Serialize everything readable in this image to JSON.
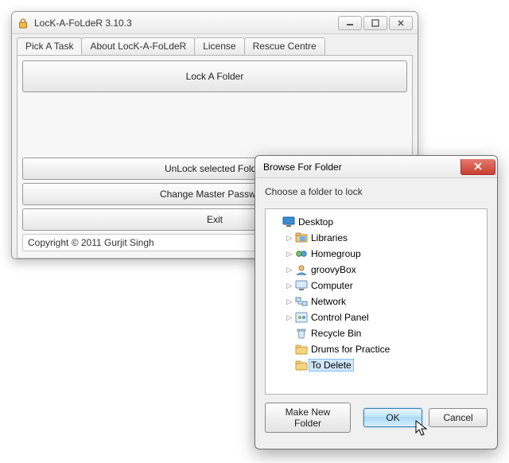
{
  "main": {
    "title": "LocK-A-FoLdeR 3.10.3",
    "tabs": [
      {
        "label": "Pick A Task"
      },
      {
        "label": "About LocK-A-FoLdeR"
      },
      {
        "label": "License"
      },
      {
        "label": "Rescue Centre"
      }
    ],
    "buttons": {
      "lock": "Lock A Folder",
      "unlock": "UnLock selected Folder",
      "change_pw": "Change Master Password",
      "exit": "Exit"
    },
    "copyright": "Copyright © 2011 Gurjit Singh"
  },
  "browse": {
    "title": "Browse For Folder",
    "instruction": "Choose a folder to lock",
    "tree": {
      "root": "Desktop",
      "items": [
        {
          "label": "Libraries",
          "icon": "libraries"
        },
        {
          "label": "Homegroup",
          "icon": "homegroup"
        },
        {
          "label": "groovyBox",
          "icon": "user"
        },
        {
          "label": "Computer",
          "icon": "computer"
        },
        {
          "label": "Network",
          "icon": "network"
        },
        {
          "label": "Control Panel",
          "icon": "control"
        },
        {
          "label": "Recycle Bin",
          "icon": "recycle",
          "noexpand": true
        },
        {
          "label": "Drums for Practice",
          "icon": "folder",
          "noexpand": true
        },
        {
          "label": "To Delete",
          "icon": "folder",
          "noexpand": true,
          "selected": true
        }
      ]
    },
    "buttons": {
      "new_folder": "Make New Folder",
      "ok": "OK",
      "cancel": "Cancel"
    }
  }
}
